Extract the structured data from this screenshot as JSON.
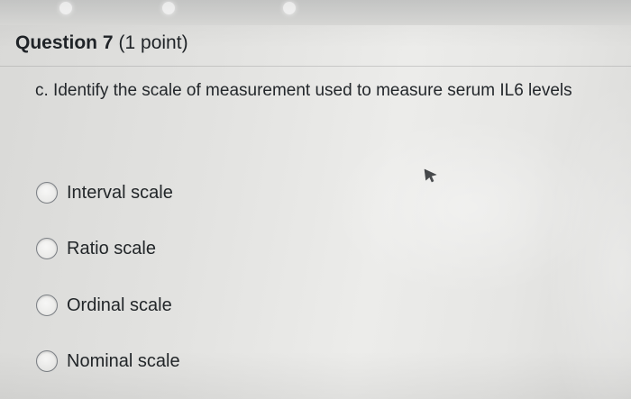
{
  "question": {
    "title": "Question 7",
    "points": "(1 point)",
    "prompt": "c. Identify the scale of measurement used to measure serum IL6 levels"
  },
  "options": [
    {
      "label": "Interval scale",
      "selected": false
    },
    {
      "label": "Ratio scale",
      "selected": false
    },
    {
      "label": "Ordinal scale",
      "selected": false
    },
    {
      "label": "Nominal scale",
      "selected": false
    }
  ],
  "icons": {
    "cursor": "mouse-pointer-icon",
    "radio": "radio-unselected"
  },
  "colors": {
    "text": "#222629",
    "radio_border": "#7b7f84",
    "background": "#e6e6e4"
  }
}
